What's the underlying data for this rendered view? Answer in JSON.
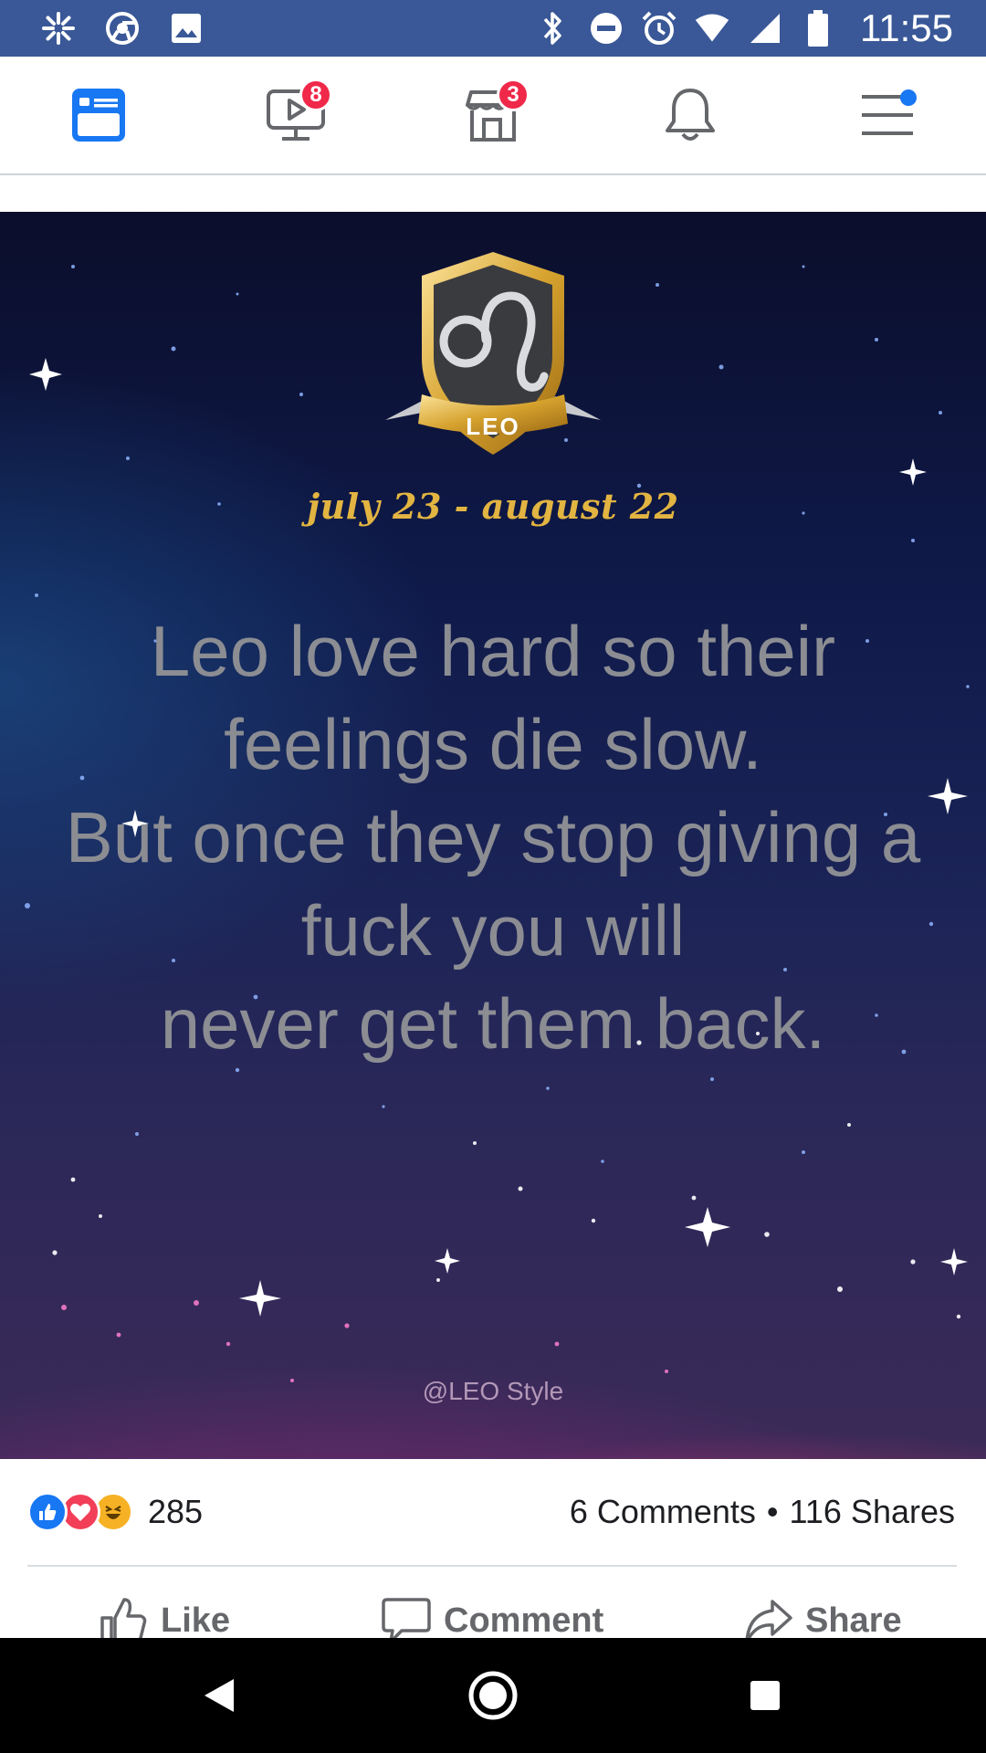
{
  "status_bar": {
    "left_icons": [
      "pinwheel-icon",
      "chrome-icon",
      "image-icon"
    ],
    "right_icons": [
      "bluetooth-icon",
      "do-not-disturb-icon",
      "alarm-icon",
      "wifi-icon",
      "signal-icon",
      "battery-icon"
    ],
    "time": "11:55",
    "bg_color": "#3a5897"
  },
  "top_nav": {
    "items": [
      {
        "name": "news-feed",
        "icon": "news-feed-icon",
        "active": true
      },
      {
        "name": "watch",
        "icon": "watch-video-icon",
        "badge": "8"
      },
      {
        "name": "marketplace",
        "icon": "marketplace-store-icon",
        "badge": "3"
      },
      {
        "name": "notifications",
        "icon": "bell-icon"
      },
      {
        "name": "menu",
        "icon": "hamburger-menu-icon",
        "dot": true
      }
    ],
    "active_color": "#1877f2",
    "badge_color": "#f02849"
  },
  "post": {
    "image": {
      "badge_label": "LEO",
      "dates": "july 23 - august 22",
      "quote_lines": [
        "Leo love hard so their",
        "feelings die slow.",
        "But once they stop giving a",
        "fuck you will",
        "never get them back."
      ],
      "watermark": "@LEO Style"
    },
    "reactions": {
      "icons": [
        "like-reaction-icon",
        "love-reaction-icon",
        "haha-reaction-icon"
      ],
      "count": "285"
    },
    "comments": "6 Comments",
    "separator": "•",
    "shares": "116 Shares",
    "actions": {
      "like": "Like",
      "comment": "Comment",
      "share": "Share"
    }
  },
  "system_nav": {
    "buttons": [
      "back-icon",
      "home-icon",
      "recents-icon"
    ]
  }
}
